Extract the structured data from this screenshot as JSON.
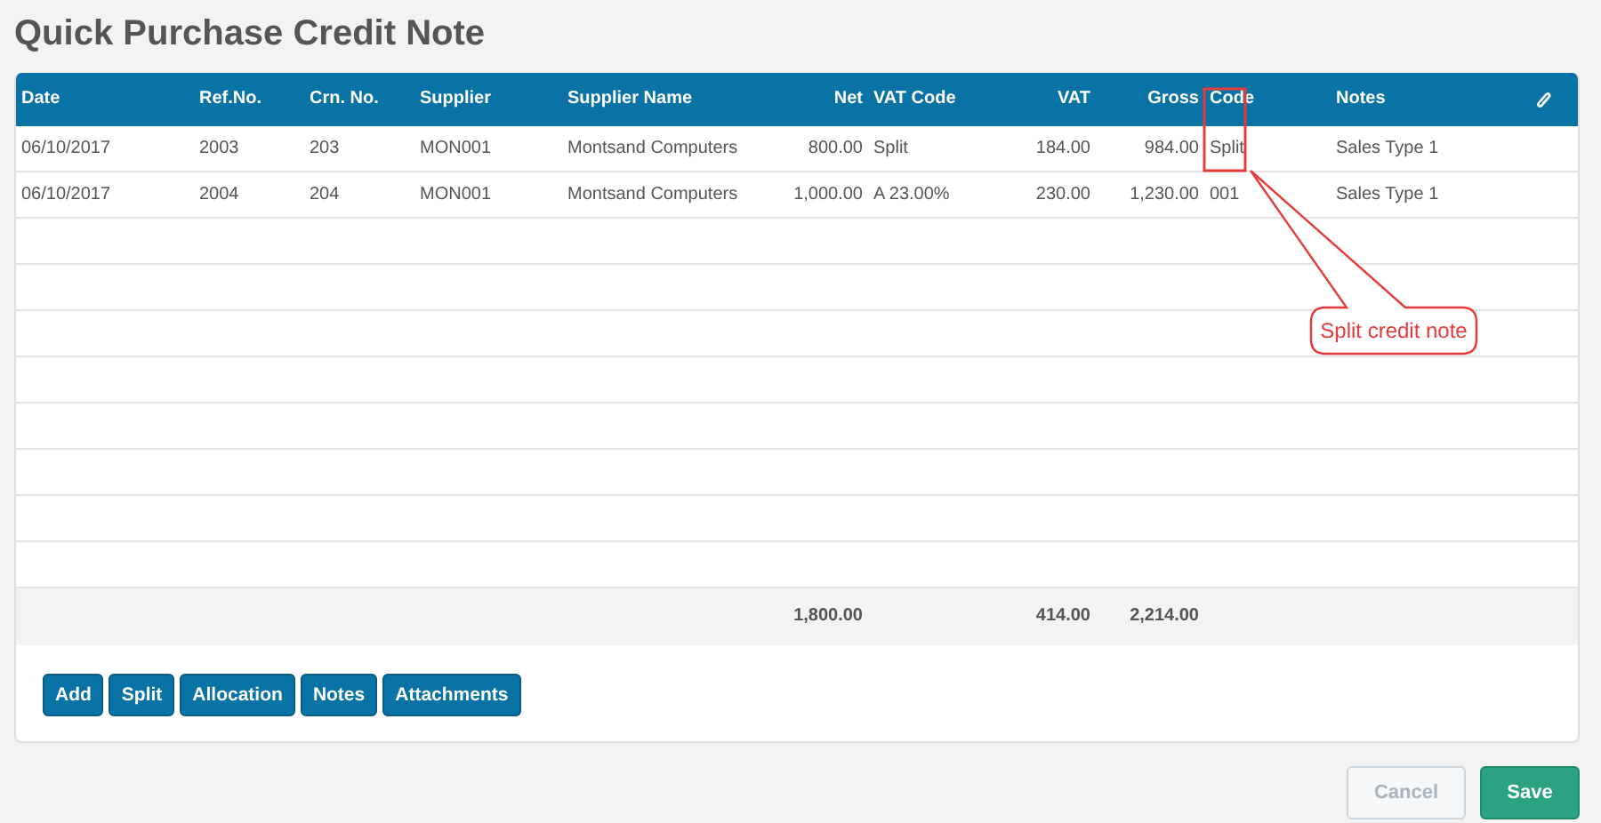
{
  "title": "Quick Purchase Credit Note",
  "table": {
    "columns": [
      {
        "label": "Date"
      },
      {
        "label": "Ref.No."
      },
      {
        "label": "Crn. No."
      },
      {
        "label": "Supplier"
      },
      {
        "label": "Supplier Name"
      },
      {
        "label": "Net"
      },
      {
        "label": "VAT Code"
      },
      {
        "label": "VAT"
      },
      {
        "label": "Gross"
      },
      {
        "label": "Code"
      },
      {
        "label": "Notes"
      }
    ],
    "rows": [
      [
        "06/10/2017",
        "2003",
        "203",
        "MON001",
        "Montsand Computers",
        "800.00",
        "Split",
        "184.00",
        "984.00",
        "Split",
        "Sales Type 1"
      ],
      [
        "06/10/2017",
        "2004",
        "204",
        "MON001",
        "Montsand Computers",
        "1,000.00",
        "A 23.00%",
        "230.00",
        "1,230.00",
        "001",
        "Sales Type 1"
      ]
    ],
    "totals": {
      "net": "1,800.00",
      "vat": "414.00",
      "gross": "2,214.00"
    }
  },
  "actions": [
    {
      "label": "Add"
    },
    {
      "label": "Split"
    },
    {
      "label": "Allocation"
    },
    {
      "label": "Notes"
    },
    {
      "label": "Attachments"
    }
  ],
  "footer_buttons": [
    {
      "label": "Cancel",
      "kind": "secondary",
      "disabled": true
    },
    {
      "label": "Save",
      "kind": "primary",
      "disabled": false
    }
  ],
  "annotation": {
    "label": "Split credit note"
  }
}
